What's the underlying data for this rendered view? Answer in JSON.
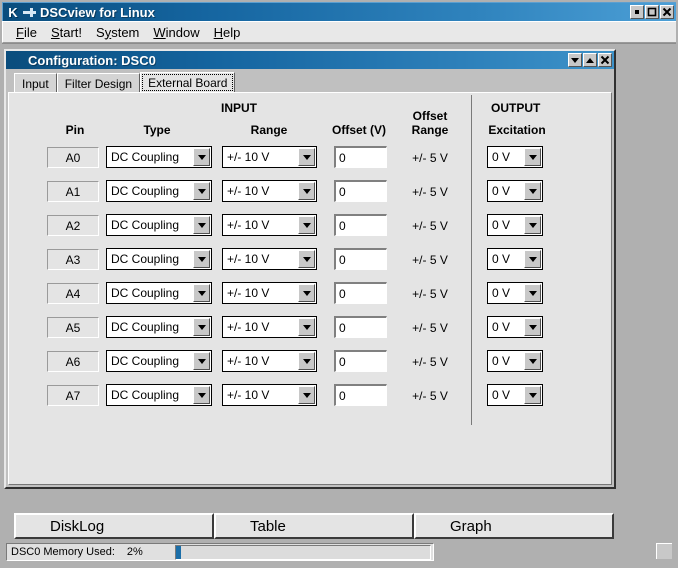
{
  "window": {
    "title": "DSCview for Linux",
    "icon": "kde-k-icon",
    "pin_icon": "pin-icon",
    "controls": [
      {
        "name": "minimize-button",
        "glyph": "minimize-icon"
      },
      {
        "name": "maximize-button",
        "glyph": "maximize-icon"
      },
      {
        "name": "close-button",
        "glyph": "close-icon"
      }
    ]
  },
  "menubar": {
    "items": [
      {
        "label": "File",
        "mnemonic": "F",
        "rest": "ile"
      },
      {
        "label": "Start!",
        "mnemonic": "S",
        "rest": "tart!"
      },
      {
        "label": "System",
        "mnemonic": "Sy",
        "rest": "stem"
      },
      {
        "label": "Window",
        "mnemonic": "W",
        "rest": "indow"
      },
      {
        "label": "Help",
        "mnemonic": "H",
        "rest": "elp"
      }
    ]
  },
  "child_window": {
    "title": "Configuration: DSC0",
    "controls": [
      {
        "name": "child-minimize-button",
        "glyph": "arrow-down-icon"
      },
      {
        "name": "child-maximize-button",
        "glyph": "arrow-up-icon"
      },
      {
        "name": "child-close-button",
        "glyph": "close-icon"
      }
    ],
    "tabs": [
      {
        "label": "Input",
        "selected": false
      },
      {
        "label": "Filter Design",
        "selected": false
      },
      {
        "label": "External Board",
        "selected": true
      }
    ]
  },
  "table": {
    "group_headers": [
      {
        "label": "INPUT"
      },
      {
        "label": "OUTPUT"
      }
    ],
    "column_headers": [
      {
        "label": "Pin"
      },
      {
        "label": "Type"
      },
      {
        "label": "Range"
      },
      {
        "label": "Offset (V)"
      },
      {
        "label": "Offset",
        "label2": "Range"
      },
      {
        "label": "Excitation"
      }
    ],
    "offset_range_header_line1": "Offset",
    "offset_range_header_line2": "Range",
    "rows": [
      {
        "pin": "A0",
        "type": "DC Coupling",
        "range": "+/- 10 V",
        "offset": "0",
        "offset_range": "+/- 5 V",
        "excitation": "0 V"
      },
      {
        "pin": "A1",
        "type": "DC Coupling",
        "range": "+/- 10 V",
        "offset": "0",
        "offset_range": "+/- 5 V",
        "excitation": "0 V"
      },
      {
        "pin": "A2",
        "type": "DC Coupling",
        "range": "+/- 10 V",
        "offset": "0",
        "offset_range": "+/- 5 V",
        "excitation": "0 V"
      },
      {
        "pin": "A3",
        "type": "DC Coupling",
        "range": "+/- 10 V",
        "offset": "0",
        "offset_range": "+/- 5 V",
        "excitation": "0 V"
      },
      {
        "pin": "A4",
        "type": "DC Coupling",
        "range": "+/- 10 V",
        "offset": "0",
        "offset_range": "+/- 5 V",
        "excitation": "0 V"
      },
      {
        "pin": "A5",
        "type": "DC Coupling",
        "range": "+/- 10 V",
        "offset": "0",
        "offset_range": "+/- 5 V",
        "excitation": "0 V"
      },
      {
        "pin": "A6",
        "type": "DC Coupling",
        "range": "+/- 10 V",
        "offset": "0",
        "offset_range": "+/- 5 V",
        "excitation": "0 V"
      },
      {
        "pin": "A7",
        "type": "DC Coupling",
        "range": "+/- 10 V",
        "offset": "0",
        "offset_range": "+/- 5 V",
        "excitation": "0 V"
      }
    ]
  },
  "bottom_buttons": [
    {
      "label": "DiskLog",
      "name": "disklog-button"
    },
    {
      "label": "Table",
      "name": "table-button"
    },
    {
      "label": "Graph",
      "name": "graph-button"
    }
  ],
  "statusbar": {
    "label": "DSC0 Memory Used:",
    "value": "2%",
    "progress_percent": 2,
    "progress_color": "#1b6ea8"
  }
}
